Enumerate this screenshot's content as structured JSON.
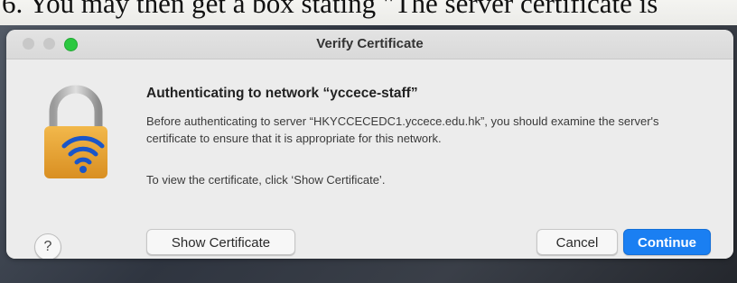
{
  "doc": {
    "caption": "6.   You may then get a box stating \"The server certificate is"
  },
  "dialog": {
    "title": "Verify Certificate",
    "heading": "Authenticating to network “yccece-staff”",
    "paragraph1": "Before authenticating to server “HKYCCECEDC1.yccece.edu.hk”, you should examine the server's certificate to ensure that it is appropriate for this network.",
    "paragraph2": "To view the certificate, click ‘Show Certificate’.",
    "help_label": "?",
    "buttons": {
      "show_certificate": "Show Certificate",
      "cancel": "Cancel",
      "continue": "Continue"
    },
    "icons": {
      "lock": "lock-wifi-icon"
    },
    "colors": {
      "accent": "#1a7ff2",
      "lock_gold": "#e9a63a",
      "wifi_blue": "#1a56c8"
    }
  }
}
